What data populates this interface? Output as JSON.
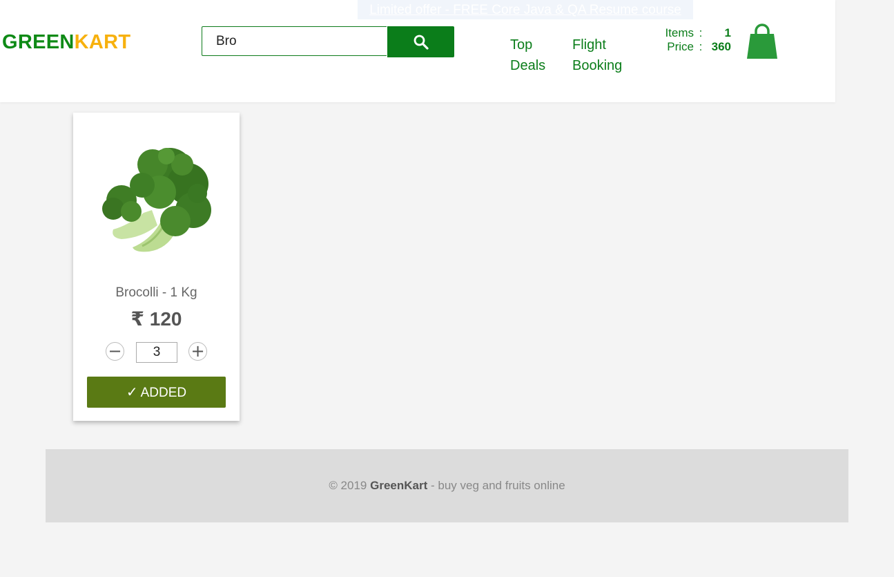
{
  "header": {
    "promo_text": "Limited offer - FREE Core Java & QA Resume course",
    "brand_green": "GREEN",
    "brand_kart": "KART",
    "search": {
      "value": "Bro"
    },
    "nav": [
      {
        "line1": "Top",
        "line2": "Deals"
      },
      {
        "line1": "Flight",
        "line2": "Booking"
      }
    ],
    "cart": {
      "items_label": "Items",
      "items_value": "1",
      "price_label": "Price",
      "price_value": "360",
      "separator": ":"
    }
  },
  "product": {
    "name": "Brocolli - 1 Kg",
    "price": "₹ 120",
    "quantity": "3",
    "decrement_symbol": "−",
    "increment_symbol": "+",
    "button_label": "ADDED",
    "button_check": "✓"
  },
  "footer": {
    "prefix": "© 2019",
    "brand": "GreenKart",
    "suffix": "- buy veg and fruits online"
  },
  "colors": {
    "brand_green": "#0e8a16",
    "brand_orange": "#f7b10e",
    "button_green": "#0b7d1a",
    "added_olive": "#5a7a14"
  },
  "icons": [
    "search-icon",
    "shopping-bag-icon"
  ]
}
